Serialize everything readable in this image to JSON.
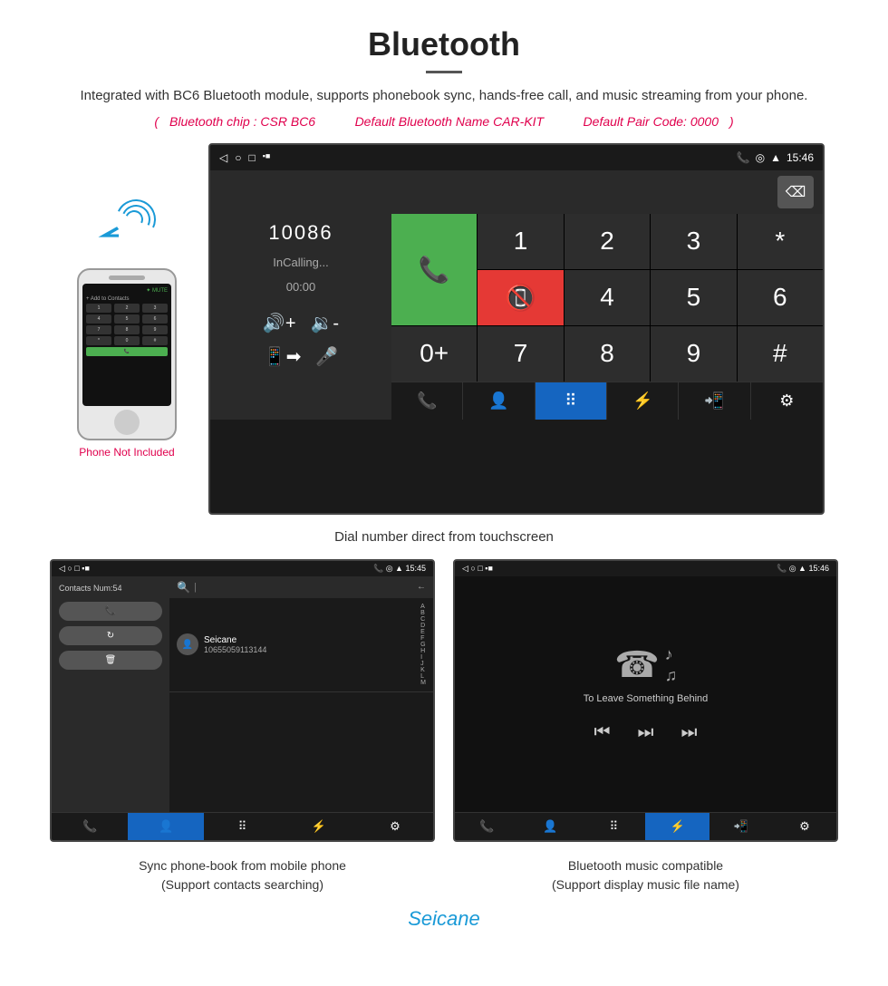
{
  "header": {
    "title": "Bluetooth",
    "description": "Integrated with BC6 Bluetooth module, supports phonebook sync, hands-free call, and music streaming from your phone.",
    "spec_chip": "Bluetooth chip : CSR BC6",
    "spec_name": "Default Bluetooth Name CAR-KIT",
    "spec_code": "Default Pair Code: 0000"
  },
  "phone_label": "Phone Not Included",
  "dial_screen": {
    "status_left": [
      "◁",
      "○",
      "□"
    ],
    "status_icons": "▪ ■",
    "status_time": "15:46",
    "number": "10086",
    "call_status": "InCalling...",
    "call_time": "00:00",
    "keys": [
      "1",
      "2",
      "3",
      "*",
      "",
      "4",
      "5",
      "6",
      "0+",
      "",
      "7",
      "8",
      "9",
      "#",
      ""
    ],
    "backspace": "⌫"
  },
  "dial_caption": "Dial number direct from touchscreen",
  "contacts_screen": {
    "status_left": "◁  ○  □  ▪ ■",
    "status_time": "15:45",
    "contacts_count": "Contacts Num:54",
    "contact_name": "Seicane",
    "contact_number": "10655059113144",
    "alpha_list": [
      "A",
      "B",
      "C",
      "D",
      "E",
      "F",
      "G",
      "H",
      "I",
      "J",
      "K",
      "L",
      "M"
    ]
  },
  "music_screen": {
    "status_time": "15:46",
    "song_title": "To Leave Something Behind"
  },
  "contacts_caption_line1": "Sync phone-book from mobile phone",
  "contacts_caption_line2": "(Support contacts searching)",
  "music_caption_line1": "Bluetooth music compatible",
  "music_caption_line2": "(Support display music file name)",
  "watermark": "Seicane"
}
